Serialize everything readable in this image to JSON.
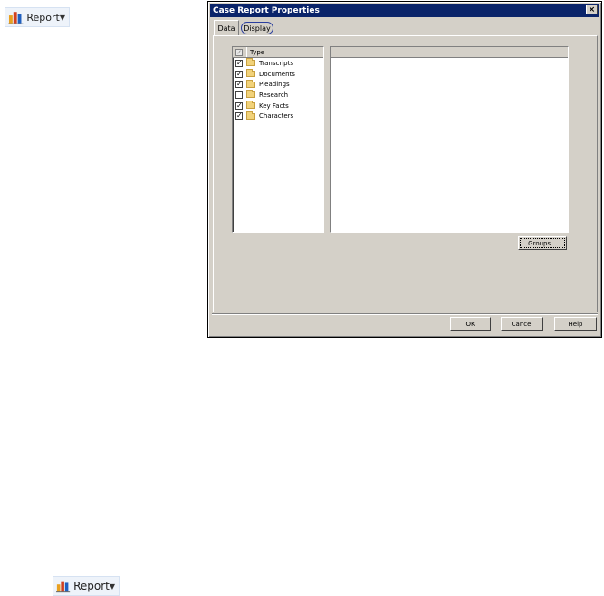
{
  "toolbar": {
    "report_label": "Report"
  },
  "dialog": {
    "title": "Case Report Properties",
    "close_glyph": "×",
    "tabs": [
      {
        "label": "Data"
      },
      {
        "label": "Display"
      }
    ],
    "type_list": {
      "header": "Type",
      "items": [
        {
          "label": "Transcripts",
          "checked": true
        },
        {
          "label": "Documents",
          "checked": true
        },
        {
          "label": "Pleadings",
          "checked": true
        },
        {
          "label": "Research",
          "checked": false
        },
        {
          "label": "Key Facts",
          "checked": true
        },
        {
          "label": "Characters",
          "checked": true
        }
      ]
    },
    "buttons": {
      "groups": "Groups...",
      "ok": "OK",
      "cancel": "Cancel",
      "help": "Help"
    }
  },
  "colors": {
    "titlebar": "#0a246a",
    "dialog_bg": "#d4d0c8",
    "highlight_ring": "#2a3e9e"
  },
  "icons": {
    "report": "bar-chart-icon",
    "list_item": "folder-icon"
  }
}
